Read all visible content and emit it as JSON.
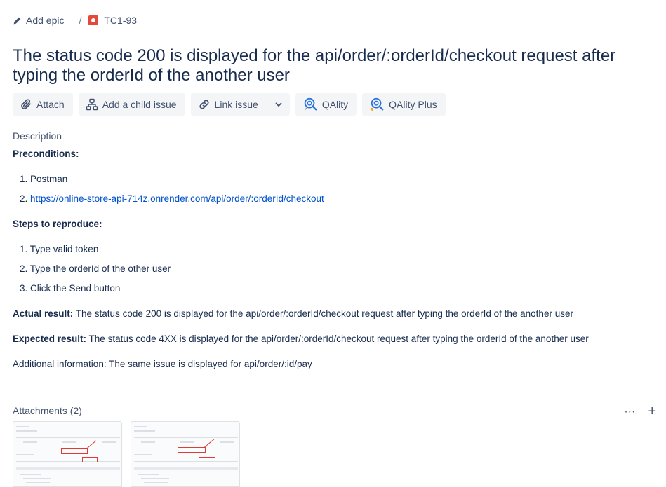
{
  "breadcrumb": {
    "epic_label": "Add epic",
    "separator": "/",
    "issue_key": "TC1-93"
  },
  "title": "The status code 200 is displayed for the api/order/:orderId/checkout request after typing the orderId of the another user",
  "toolbar": {
    "attach": "Attach",
    "add_child": "Add a child issue",
    "link_issue": "Link issue",
    "qality": "QAlity",
    "qality_plus": "QAlity Plus"
  },
  "description": {
    "label": "Description",
    "preconditions_heading": "Preconditions:",
    "preconditions": [
      "1. Postman",
      "2. "
    ],
    "precondition_link": "https://online-store-api-714z.onrender.com/api/order/:orderId/checkout",
    "steps_heading": "Steps to reproduce:",
    "steps": [
      "1. Type valid token",
      "2. Type the orderId of the other user",
      "3. Click the Send button"
    ],
    "actual_label": "Actual result:",
    "actual_text": " The status code 200 is displayed for the api/order/:orderId/checkout request after typing the orderId of the another user",
    "expected_label": "Expected result:",
    "expected_text": " The status code 4XX is displayed for the api/order/:orderId/checkout request after typing the orderId of the another user",
    "additional": "Additional information: The same issue is displayed for api/order/:id/pay"
  },
  "attachments": {
    "label": "Attachments (2)",
    "more": "···",
    "add": "+"
  },
  "icons": {
    "edit": "pencil-icon",
    "bug": "bug-icon",
    "attach": "paperclip-icon",
    "child": "hierarchy-icon",
    "link": "link-icon",
    "dropdown": "chevron-down-icon",
    "qality": "qality-icon"
  },
  "colors": {
    "link": "#0052cc",
    "bug": "#e5493a",
    "button_bg": "#f4f5f7",
    "text": "#172b4d"
  }
}
